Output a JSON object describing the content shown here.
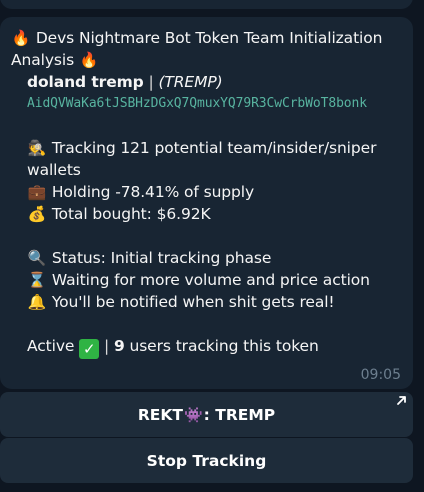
{
  "message": {
    "title": "Devs Nightmare Bot Token Team Initialization Analysis",
    "token_name": "doland tremp",
    "separator": "|",
    "token_ticker": "(TREMP)",
    "contract_address": "AidQVWaKa6tJSBHzDGxQ7QmuxYQ79R3CwCrbWoT8bonk",
    "tracking_text": "Tracking 121 potential team/insider/sniper wallets",
    "holding_text": "Holding -78.41% of supply",
    "bought_text": "Total bought: $6.92K",
    "status_text": "Status: Initial tracking phase",
    "waiting_text": "Waiting for more volume and price action",
    "notify_text": "You'll be notified when shit gets real!",
    "active_label": "Active",
    "users_count": "9",
    "users_text": "users tracking this token",
    "timestamp": "09:05"
  },
  "buttons": {
    "rekt_prefix": "REKT",
    "rekt_suffix": ": TREMP",
    "stop_tracking": "Stop Tracking"
  },
  "icons": {
    "fire": "fire-icon",
    "spy": "detective-icon",
    "briefcase": "briefcase-icon",
    "money_bag": "money-bag-icon",
    "magnifier": "magnifier-icon",
    "hourglass": "hourglass-icon",
    "bell": "bell-icon",
    "check": "check-mark-icon",
    "alien": "alien-monster-icon",
    "external": "external-link-icon"
  },
  "colors": {
    "background": "#0e1621",
    "bubble": "#182533",
    "button": "#1e2c3a",
    "address": "#58b4a0",
    "timestamp": "#6d7f8f",
    "check": "#2fb344"
  }
}
